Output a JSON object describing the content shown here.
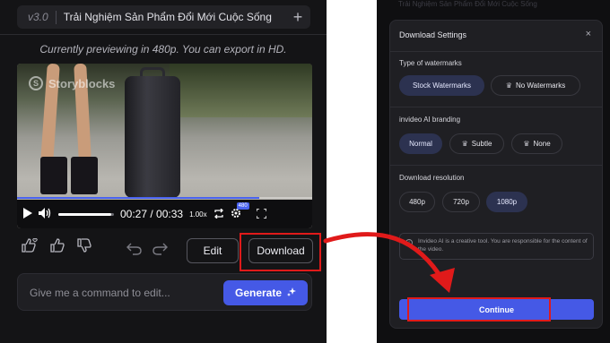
{
  "left_panel": {
    "version": "v3.0",
    "tab_title": "Trải Nghiệm Sản Phẩm Đổi Mới Cuộc Sống",
    "plus_symbol": "+",
    "preview_note": "Currently previewing in 480p. You can export in HD.",
    "video": {
      "watermark": "Storyblocks",
      "progress_fraction": 0.82,
      "volume_fraction": 0.95,
      "time": "00:27 / 00:33",
      "speed": "1.00x",
      "quality_badge": "480"
    },
    "actions": {
      "edit_label": "Edit",
      "download_label": "Download"
    },
    "command": {
      "placeholder": "Give me a command to edit...",
      "generate_label": "Generate"
    }
  },
  "dialog": {
    "ghost_title": "Trải Nghiệm Sản Phẩm Đổi Mới Cuộc Sống",
    "title": "Download Settings",
    "close_symbol": "×",
    "watermark_section": {
      "label": "Type of watermarks",
      "options": [
        "Stock Watermarks",
        "No Watermarks"
      ],
      "selected": "Stock Watermarks"
    },
    "branding_section": {
      "label": "invideo AI branding",
      "options": [
        "Normal",
        "Subtle",
        "None"
      ],
      "selected": "Normal"
    },
    "resolution_section": {
      "label": "Download resolution",
      "options": [
        "480p",
        "720p",
        "1080p"
      ],
      "selected": "1080p"
    },
    "notice": "Invideo AI is a creative tool. You are responsible for the content of the video.",
    "continue_label": "Continue"
  },
  "colors": {
    "accent": "#4559e6",
    "highlight_red": "#e01a1a",
    "panel_bg": "#141416",
    "dialog_bg": "#1f1f23"
  }
}
